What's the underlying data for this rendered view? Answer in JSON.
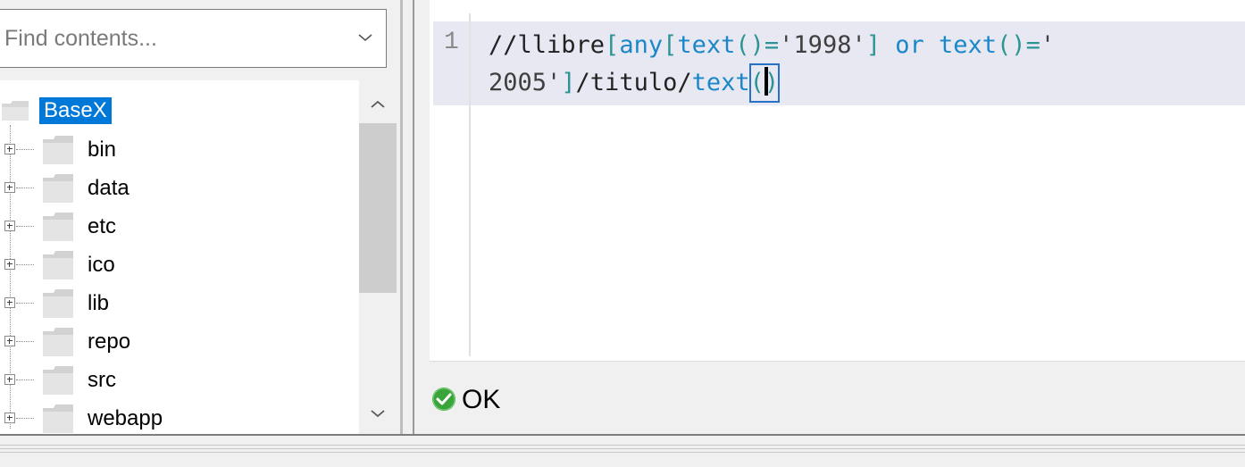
{
  "search": {
    "placeholder": "Find contents..."
  },
  "tree": {
    "root": {
      "label": "BaseX"
    },
    "items": [
      {
        "label": "bin"
      },
      {
        "label": "data"
      },
      {
        "label": "etc"
      },
      {
        "label": "ico"
      },
      {
        "label": "lib"
      },
      {
        "label": "repo"
      },
      {
        "label": "src"
      },
      {
        "label": "webapp"
      }
    ]
  },
  "editor": {
    "line_number": "1",
    "code": {
      "p1": "//llibre",
      "p2": "[",
      "p3": "any",
      "p4": "[",
      "p5": "text",
      "p6": "()",
      "p7": "=",
      "p8": "'1998'",
      "p9": "]",
      "p10": " or ",
      "p11": "text",
      "p12": "()",
      "p13": "=",
      "p14": "'",
      "p15": "2005'",
      "p16": "]",
      "p17": "/titulo/",
      "p18": "text",
      "p19": "(",
      "p20": ")"
    }
  },
  "status": {
    "text": "OK",
    "icon": "check-circle-icon",
    "color": "#3aa33a"
  },
  "colors": {
    "selection": "#0078d7",
    "keyword": "#1a87c8",
    "punctuation": "#2c9494",
    "line_highlight": "#e8e8f3"
  }
}
